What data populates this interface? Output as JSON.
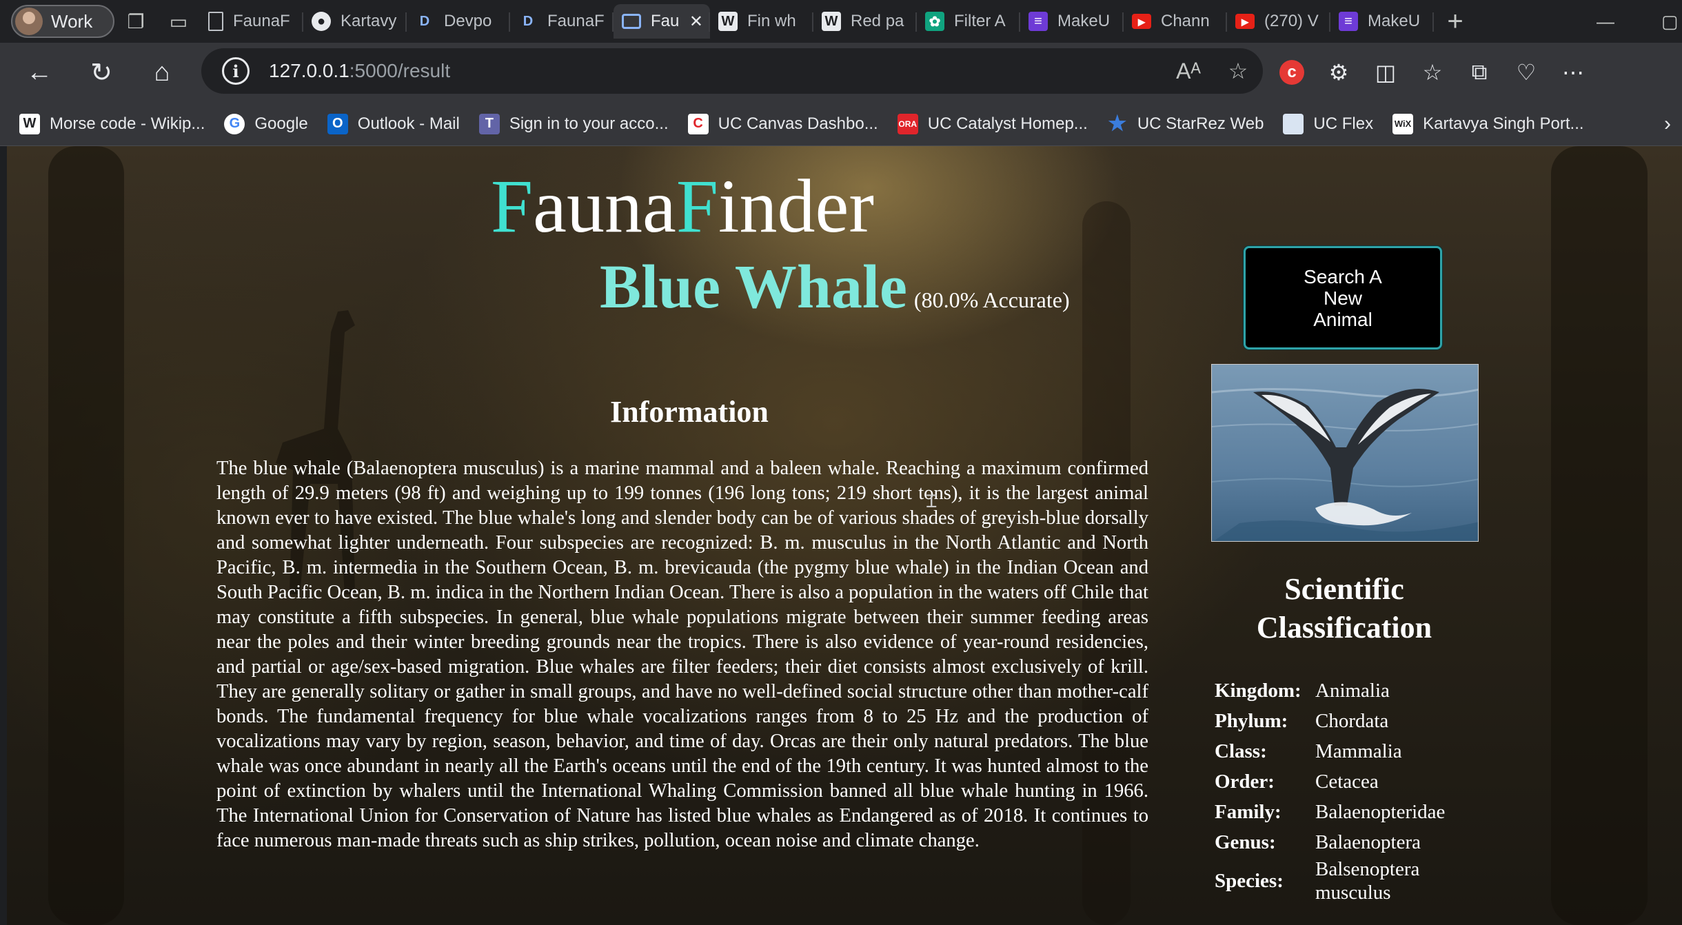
{
  "browser": {
    "profile_label": "Work",
    "tabs": [
      {
        "title": "FaunaF",
        "icon": "doc"
      },
      {
        "title": "Kartavy",
        "icon": "github"
      },
      {
        "title": "Devpo",
        "icon": "D"
      },
      {
        "title": "FaunaF",
        "icon": "D"
      },
      {
        "title": "Fau",
        "icon": "window",
        "active": true
      },
      {
        "title": "Fin wh",
        "icon": "W"
      },
      {
        "title": "Red pa",
        "icon": "W"
      },
      {
        "title": "Filter A",
        "icon": "openai"
      },
      {
        "title": "MakeU",
        "icon": "list"
      },
      {
        "title": "Chann",
        "icon": "youtube"
      },
      {
        "title": "(270) V",
        "icon": "youtube"
      },
      {
        "title": "MakeU",
        "icon": "list"
      }
    ],
    "url_host": "127.0.0.1",
    "url_rest": ":5000/result",
    "bookmarks": [
      {
        "label": "Morse code - Wikip...",
        "icon": "W",
        "color": "#ffffff"
      },
      {
        "label": "Google",
        "icon": "G",
        "color": "#4285f4"
      },
      {
        "label": "Outlook - Mail",
        "icon": "O",
        "color": "#0a64c8"
      },
      {
        "label": "Sign in to your acco...",
        "icon": "T",
        "color": "#6264a7"
      },
      {
        "label": "UC Canvas Dashbo...",
        "icon": "C",
        "color": "#e0252b"
      },
      {
        "label": "UC Catalyst Homep...",
        "icon": "O",
        "color": "#e0252b"
      },
      {
        "label": "UC StarRez Web",
        "icon": "★",
        "color": "#3b7ddd"
      },
      {
        "label": "UC Flex",
        "icon": "F",
        "color": "#d9e4f2"
      },
      {
        "label": "Kartavya Singh Port...",
        "icon": "wix",
        "color": "#ffffff"
      }
    ]
  },
  "page": {
    "brand_first": "F",
    "brand_mid": "auna",
    "brand_second": "F",
    "brand_end": "inder",
    "animal_name": "Blue Whale",
    "accuracy": "(80.0% Accurate)",
    "info_heading": "Information",
    "description": "The blue whale (Balaenoptera musculus) is a marine mammal and a baleen whale. Reaching a maximum confirmed length of 29.9 meters (98 ft) and weighing up to 199 tonnes (196 long tons; 219 short tons), it is the largest animal known ever to have existed. The blue whale's long and slender body can be of various shades of greyish-blue dorsally and somewhat lighter underneath. Four subspecies are recognized: B. m. musculus in the North Atlantic and North Pacific, B. m. intermedia in the Southern Ocean, B. m. brevicauda (the pygmy blue whale) in the Indian Ocean and South Pacific Ocean, B. m. indica in the Northern Indian Ocean. There is also a population in the waters off Chile that may constitute a fifth subspecies. In general, blue whale populations migrate between their summer feeding areas near the poles and their winter breeding grounds near the tropics. There is also evidence of year-round residencies, and partial or age/sex-based migration. Blue whales are filter feeders; their diet consists almost exclusively of krill. They are generally solitary or gather in small groups, and have no well-defined social structure other than mother-calf bonds. The fundamental frequency for blue whale vocalizations ranges from 8 to 25 Hz and the production of vocalizations may vary by region, season, behavior, and time of day. Orcas are their only natural predators. The blue whale was once abundant in nearly all the Earth's oceans until the end of the 19th century. It was hunted almost to the point of extinction by whalers until the International Whaling Commission banned all blue whale hunting in 1966. The International Union for Conservation of Nature has listed blue whales as Endangered as of 2018. It continues to face numerous man-made threats such as ship strikes, pollution, ocean noise and climate change.",
    "search_button": "Search A New Animal",
    "sci_heading": "Scientific Classification",
    "classification": [
      {
        "key": "Kingdom:",
        "value": "Animalia"
      },
      {
        "key": "Phylum:",
        "value": "Chordata"
      },
      {
        "key": "Class:",
        "value": "Mammalia"
      },
      {
        "key": "Order:",
        "value": "Cetacea"
      },
      {
        "key": "Family:",
        "value": "Balaenopteridae"
      },
      {
        "key": "Genus:",
        "value": "Balaenoptera"
      },
      {
        "key": "Species:",
        "value": "Balsenoptera musculus"
      }
    ],
    "accent_color": "#40e0d0"
  }
}
